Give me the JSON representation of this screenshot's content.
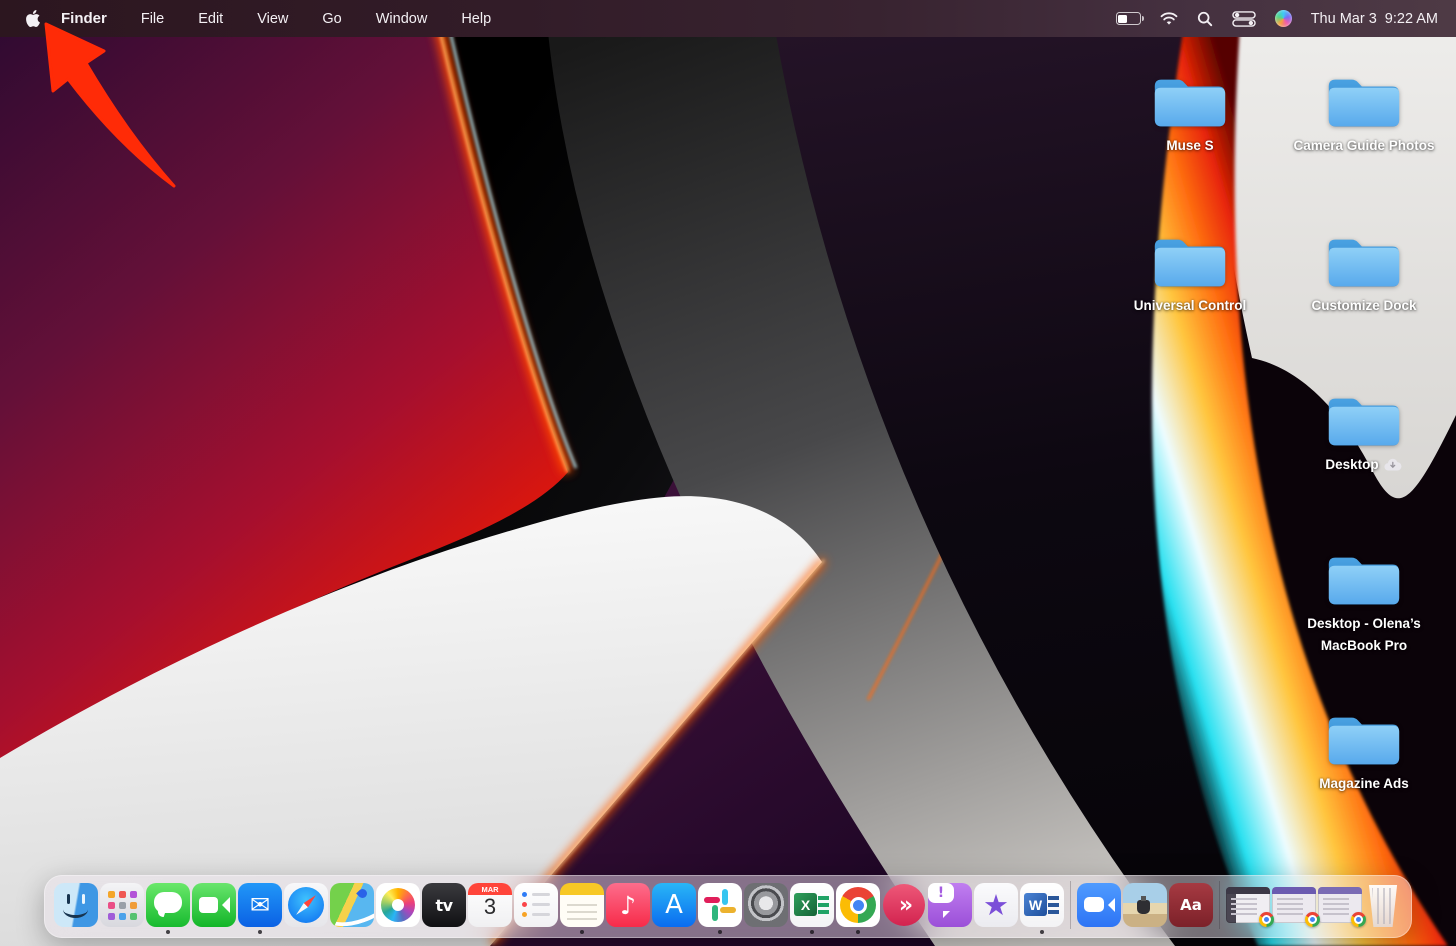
{
  "wallpaper": {
    "style": "macOS Monterey abstract swirl",
    "accent_colors": [
      "#2c0a31",
      "#d8160f",
      "#ff7112",
      "#27e0f0",
      "#efeeec"
    ]
  },
  "menu_bar": {
    "app_menu": "Finder",
    "menus": [
      "File",
      "Edit",
      "View",
      "Go",
      "Window",
      "Help"
    ],
    "status_icons": [
      "battery",
      "wifi",
      "spotlight",
      "control-center",
      "siri"
    ],
    "clock": {
      "date": "Thu Mar 3",
      "time": "9:22 AM"
    }
  },
  "annotation": {
    "type": "red-arrow",
    "color": "#ff2b07",
    "target": "apple-menu"
  },
  "desktop": {
    "folders": [
      {
        "name": "Muse S"
      },
      {
        "name": "Camera Guide Photos"
      },
      {
        "name": "Universal Control"
      },
      {
        "name": "Customize Dock"
      },
      {
        "name": "Desktop",
        "icloud": true
      },
      {
        "name": "Desktop - Olena’s MacBook Pro"
      },
      {
        "name": "Magazine Ads"
      }
    ]
  },
  "dock": {
    "items": [
      {
        "id": "finder",
        "label": "Finder",
        "running": true
      },
      {
        "id": "launchpad",
        "label": "Launchpad",
        "running": false
      },
      {
        "id": "messages",
        "label": "Messages",
        "running": true
      },
      {
        "id": "facetime",
        "label": "FaceTime",
        "running": false
      },
      {
        "id": "mail",
        "label": "Mail",
        "glyph": "✉",
        "running": true
      },
      {
        "id": "safari",
        "label": "Safari",
        "running": false
      },
      {
        "id": "maps",
        "label": "Maps",
        "running": false
      },
      {
        "id": "photos",
        "label": "Photos",
        "running": false
      },
      {
        "id": "appletv",
        "label": "Apple TV",
        "glyph": "tv",
        "running": false
      },
      {
        "id": "calendar",
        "label": "Calendar",
        "glyph_top": "MAR",
        "glyph": "3",
        "running": false
      },
      {
        "id": "reminders",
        "label": "Reminders",
        "running": false
      },
      {
        "id": "notes",
        "label": "Notes",
        "running": true
      },
      {
        "id": "music",
        "label": "Music",
        "glyph": "♪",
        "running": false
      },
      {
        "id": "appstore",
        "label": "App Store",
        "glyph": "A",
        "running": false
      },
      {
        "id": "slack",
        "label": "Slack",
        "running": true
      },
      {
        "id": "sysprefs",
        "label": "System Preferences",
        "running": false
      },
      {
        "id": "excel",
        "label": "Microsoft Excel",
        "glyph": "X",
        "running": true
      },
      {
        "id": "chrome",
        "label": "Google Chrome",
        "running": true
      },
      {
        "id": "skitch",
        "label": "Skitch",
        "glyph": "»",
        "running": false
      },
      {
        "id": "feedback",
        "label": "Feedback",
        "glyph": "!",
        "running": false
      },
      {
        "id": "imovie",
        "label": "iMovie",
        "glyph": "★",
        "running": false
      },
      {
        "id": "word",
        "label": "Microsoft Word",
        "glyph": "W",
        "running": true
      },
      {
        "type": "divider"
      },
      {
        "id": "zoomapp",
        "label": "Zoom",
        "running": false
      },
      {
        "id": "preview",
        "label": "Preview",
        "running": false
      },
      {
        "id": "dictionary",
        "label": "Dictionary",
        "glyph": "Aa",
        "running": false
      },
      {
        "type": "divider"
      },
      {
        "id": "minwin1",
        "label": "Minimized Chrome Window 1",
        "type": "window",
        "variant": "a"
      },
      {
        "id": "minwin2",
        "label": "Minimized Chrome Window 2",
        "type": "window",
        "variant": "b"
      },
      {
        "id": "minwin3",
        "label": "Minimized Chrome Window 3",
        "type": "window",
        "variant": "c"
      },
      {
        "id": "trash",
        "label": "Trash",
        "type": "trash"
      }
    ]
  }
}
